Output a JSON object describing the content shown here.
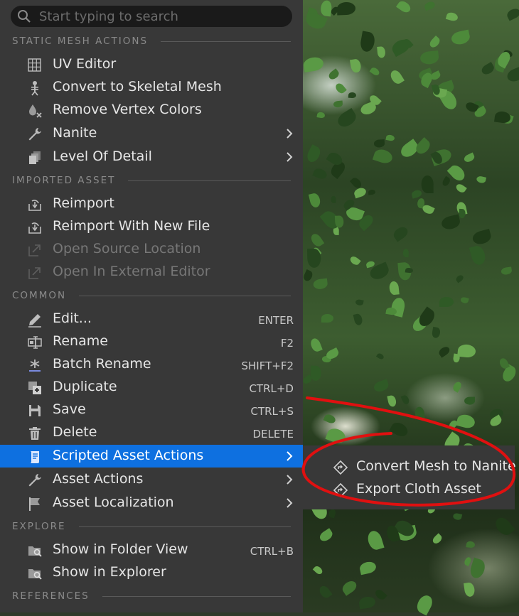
{
  "search": {
    "placeholder": "Start typing to search"
  },
  "sections": {
    "static_mesh": "STATIC MESH ACTIONS",
    "imported": "IMPORTED ASSET",
    "common": "COMMON",
    "explore": "EXPLORE",
    "references": "REFERENCES"
  },
  "static_mesh_items": [
    {
      "label": "UV Editor",
      "icon": "grid-icon"
    },
    {
      "label": "Convert to Skeletal Mesh",
      "icon": "skeleton-icon"
    },
    {
      "label": "Remove Vertex Colors",
      "icon": "color-drop-remove-icon"
    },
    {
      "label": "Nanite",
      "icon": "wrench-icon",
      "submenu": true
    },
    {
      "label": "Level Of Detail",
      "icon": "lod-icon",
      "submenu": true
    }
  ],
  "imported_items": [
    {
      "label": "Reimport",
      "icon": "reimport-icon"
    },
    {
      "label": "Reimport With New File",
      "icon": "reimport-icon"
    },
    {
      "label": "Open Source Location",
      "icon": "open-external-icon",
      "disabled": true
    },
    {
      "label": "Open In External Editor",
      "icon": "open-external-icon",
      "disabled": true
    }
  ],
  "common_items": [
    {
      "label": "Edit...",
      "shortcut": "ENTER",
      "icon": "pencil-icon"
    },
    {
      "label": "Rename",
      "shortcut": "F2",
      "icon": "rename-icon"
    },
    {
      "label": "Batch Rename",
      "shortcut": "SHIFT+F2",
      "icon": "batch-rename-icon"
    },
    {
      "label": "Duplicate",
      "shortcut": "CTRL+D",
      "icon": "duplicate-icon"
    },
    {
      "label": "Save",
      "shortcut": "CTRL+S",
      "icon": "save-icon"
    },
    {
      "label": "Delete",
      "shortcut": "DELETE",
      "icon": "trash-icon"
    },
    {
      "label": "Scripted Asset Actions",
      "icon": "script-icon",
      "submenu": true,
      "highlighted": true
    },
    {
      "label": "Asset Actions",
      "icon": "wrench-icon",
      "submenu": true
    },
    {
      "label": "Asset Localization",
      "icon": "flag-icon",
      "submenu": true
    }
  ],
  "explore_items": [
    {
      "label": "Show in Folder View",
      "shortcut": "CTRL+B",
      "icon": "folder-search-icon"
    },
    {
      "label": "Show in Explorer",
      "icon": "folder-search-icon"
    }
  ],
  "submenu_items": [
    {
      "label": "Convert Mesh to Nanite",
      "icon": "diamond-arrow-icon"
    },
    {
      "label": "Export Cloth Asset",
      "icon": "diamond-arrow-icon"
    }
  ],
  "colors": {
    "menu_bg": "#383838",
    "highlight": "#0e70e0",
    "annotation": "#e01010"
  }
}
